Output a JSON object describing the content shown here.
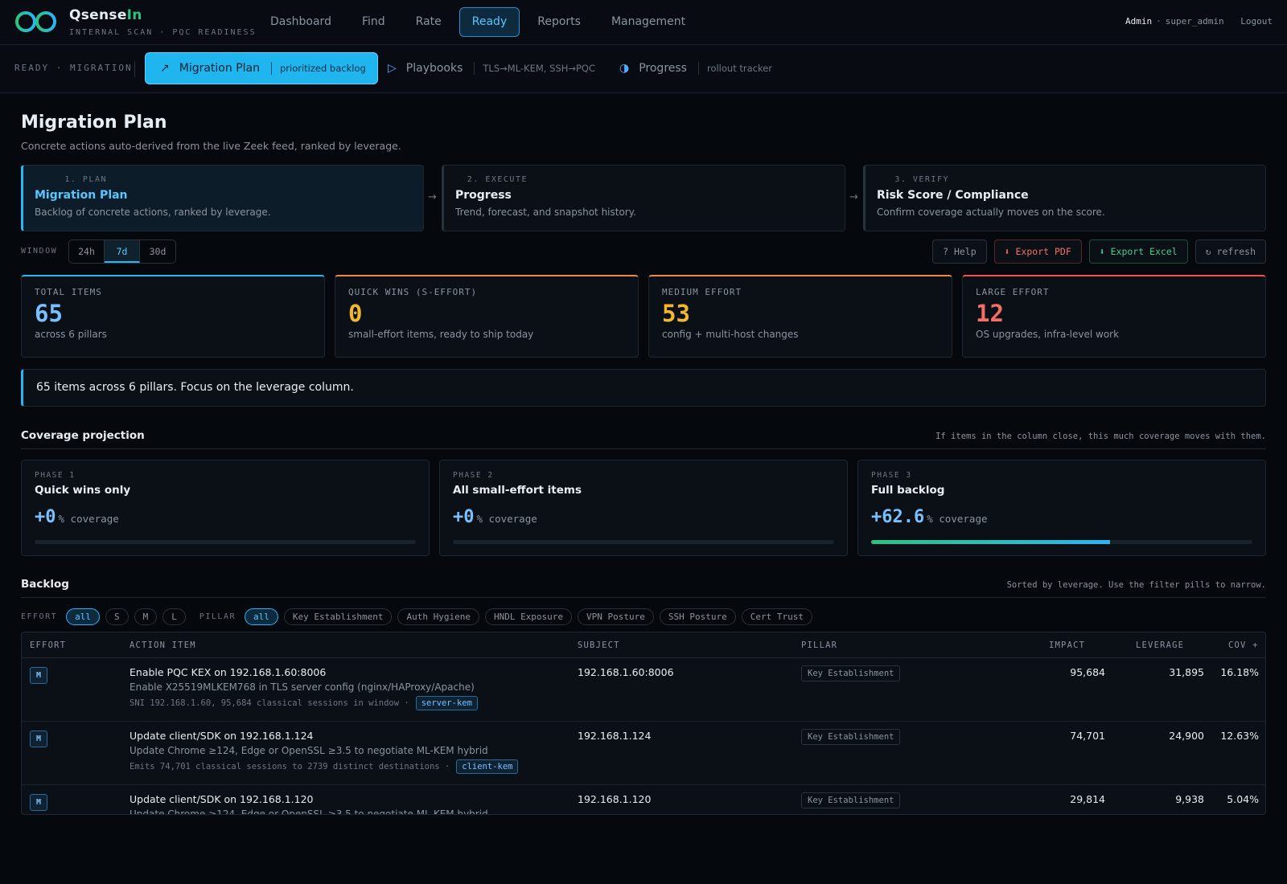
{
  "app": {
    "name_a": "Qsense",
    "name_b": "In",
    "subtitle": "INTERNAL SCAN · PQC READINESS"
  },
  "nav": {
    "items": [
      {
        "label": "Dashboard"
      },
      {
        "label": "Find"
      },
      {
        "label": "Rate"
      },
      {
        "label": "Ready"
      },
      {
        "label": "Reports"
      },
      {
        "label": "Management"
      }
    ],
    "active": "Ready"
  },
  "user": {
    "role": "Admin",
    "sep": "·",
    "name": "super_admin",
    "logout": "Logout"
  },
  "subnav": {
    "crumb": "READY · MIGRATION",
    "tabs": [
      {
        "icon": "↗",
        "label": "Migration Plan",
        "desc": "prioritized backlog"
      },
      {
        "icon": "▷",
        "label": "Playbooks",
        "desc": "TLS→ML-KEM, SSH→PQC"
      },
      {
        "icon": "◑",
        "label": "Progress",
        "desc": "rollout tracker"
      }
    ]
  },
  "page": {
    "title": "Migration Plan",
    "subtitle": "Concrete actions auto-derived from the live Zeek feed, ranked by leverage."
  },
  "steps": [
    {
      "num": "1. PLAN",
      "title": "Migration Plan",
      "desc": "Backlog of concrete actions, ranked by leverage."
    },
    {
      "num": "2. EXECUTE",
      "title": "Progress",
      "desc": "Trend, forecast, and snapshot history."
    },
    {
      "num": "3. VERIFY",
      "title": "Risk Score / Compliance",
      "desc": "Confirm coverage actually moves on the score."
    }
  ],
  "step_arrow": "→",
  "window": {
    "label": "WINDOW",
    "options": [
      "24h",
      "7d",
      "30d"
    ],
    "active": "7d"
  },
  "actions": {
    "help": "? Help",
    "pdf": "⬇ Export PDF",
    "excel": "⬇ Export Excel",
    "refresh": "↻ refresh"
  },
  "kpis": [
    {
      "label": "TOTAL ITEMS",
      "value": "65",
      "sub": "across 6 pillars",
      "color": "#79c0ff"
    },
    {
      "label": "QUICK WINS (S-EFFORT)",
      "value": "0",
      "sub": "small-effort items, ready to ship today",
      "color": "#f0b72f"
    },
    {
      "label": "MEDIUM EFFORT",
      "value": "53",
      "sub": "config + multi-host changes",
      "color": "#f0b72f"
    },
    {
      "label": "LARGE EFFORT",
      "value": "12",
      "sub": "OS upgrades, infra-level work",
      "color": "#f47067"
    }
  ],
  "kpi_borders": [
    "#2ab6f5",
    "#f0883e",
    "#f0883e",
    "#f85149"
  ],
  "banner": "65 items across 6 pillars. Focus on the leverage column.",
  "coverage": {
    "title": "Coverage projection",
    "note": "If items in the column close, this much coverage moves with them.",
    "phases": [
      {
        "num": "PHASE 1",
        "title": "Quick wins only",
        "value": "+0",
        "unit": "% coverage",
        "fill_pct": 0
      },
      {
        "num": "PHASE 2",
        "title": "All small-effort items",
        "value": "+0",
        "unit": "% coverage",
        "fill_pct": 0
      },
      {
        "num": "PHASE 3",
        "title": "Full backlog",
        "value": "+62.6",
        "unit": "% coverage",
        "fill_pct": 62.6
      }
    ]
  },
  "backlog": {
    "title": "Backlog",
    "note": "Sorted by leverage. Use the filter pills to narrow.",
    "effort_label": "EFFORT",
    "effort_pills": [
      "all",
      "S",
      "M",
      "L"
    ],
    "effort_active": "all",
    "pillar_label": "PILLAR",
    "pillar_pills": [
      "all",
      "Key Establishment",
      "Auth Hygiene",
      "HNDL Exposure",
      "VPN Posture",
      "SSH Posture",
      "Cert Trust"
    ],
    "pillar_active": "all",
    "columns": [
      "EFFORT",
      "ACTION ITEM",
      "SUBJECT",
      "PILLAR",
      "IMPACT",
      "LEVERAGE",
      "COV +"
    ],
    "rows": [
      {
        "effort": "M",
        "title": "Enable PQC KEX on 192.168.1.60:8006",
        "desc": "Enable X25519MLKEM768 in TLS server config (nginx/HAProxy/Apache)",
        "note": "SNI 192.168.1.60, 95,684 classical sessions in window ·",
        "tag": "server-kem",
        "subject": "192.168.1.60:8006",
        "pillar": "Key Establishment",
        "impact": "95,684",
        "leverage": "31,895",
        "cov": "16.18%"
      },
      {
        "effort": "M",
        "title": "Update client/SDK on 192.168.1.124",
        "desc": "Update Chrome ≥124, Edge or OpenSSL ≥3.5 to negotiate ML-KEM hybrid",
        "note": "Emits 74,701 classical sessions to 2739 distinct destinations ·",
        "tag": "client-kem",
        "subject": "192.168.1.124",
        "pillar": "Key Establishment",
        "impact": "74,701",
        "leverage": "24,900",
        "cov": "12.63%"
      },
      {
        "effort": "M",
        "title": "Update client/SDK on 192.168.1.120",
        "desc": "Update Chrome ≥124, Edge or OpenSSL ≥3.5 to negotiate ML-KEM hybrid",
        "note": "",
        "tag": "",
        "subject": "192.168.1.120",
        "pillar": "Key Establishment",
        "impact": "29,814",
        "leverage": "9,938",
        "cov": "5.04%"
      }
    ]
  }
}
